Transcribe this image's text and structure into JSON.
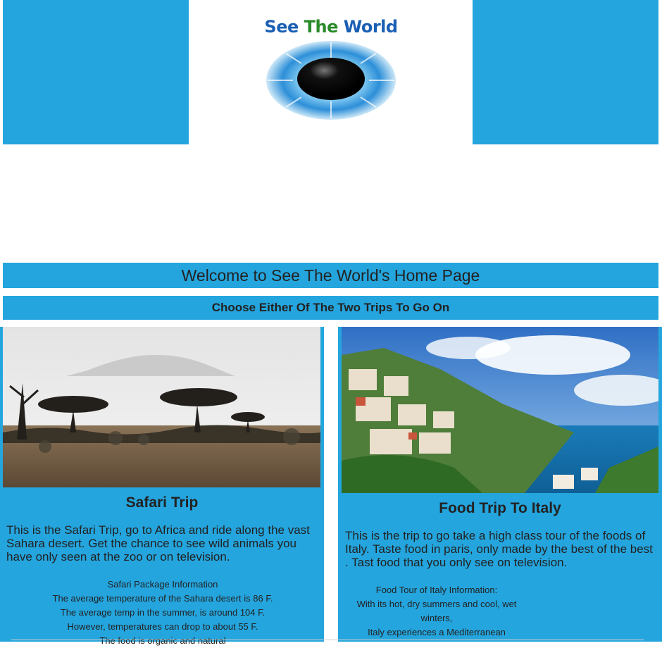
{
  "colors": {
    "primary_blue": "#24a5de",
    "text": "#222222"
  },
  "logo": {
    "part1": "See ",
    "part2": "The ",
    "part3": "World"
  },
  "welcome": "Welcome to See The World's Home Page",
  "choose": "Choose Either Of The Two Trips To Go On",
  "safari": {
    "title": "Safari Trip",
    "description": "This is the Safari Trip, go to Africa and ride along the vast Sahara desert. Get the chance to see wild animals you have only seen at the zoo or on television.",
    "info": [
      "Safari Package Information",
      "The average temperature of the Sahara desert is 86 F.",
      "The average temp in the summer, is around 104 F.",
      "However, temperatures can drop to about 55 F.",
      "The food is organic and natural"
    ]
  },
  "italy": {
    "title": "Food Trip To Italy",
    "description": "This is the trip to go take a high class tour of the foods of Italy. Taste food in paris, only made by the best of the best . Tast food that you only see on television.",
    "info": [
      "Food Tour of Italy Information:",
      "With its hot, dry summers and cool, wet",
      "winters,",
      "Italy experiences a Mediterranean"
    ]
  }
}
